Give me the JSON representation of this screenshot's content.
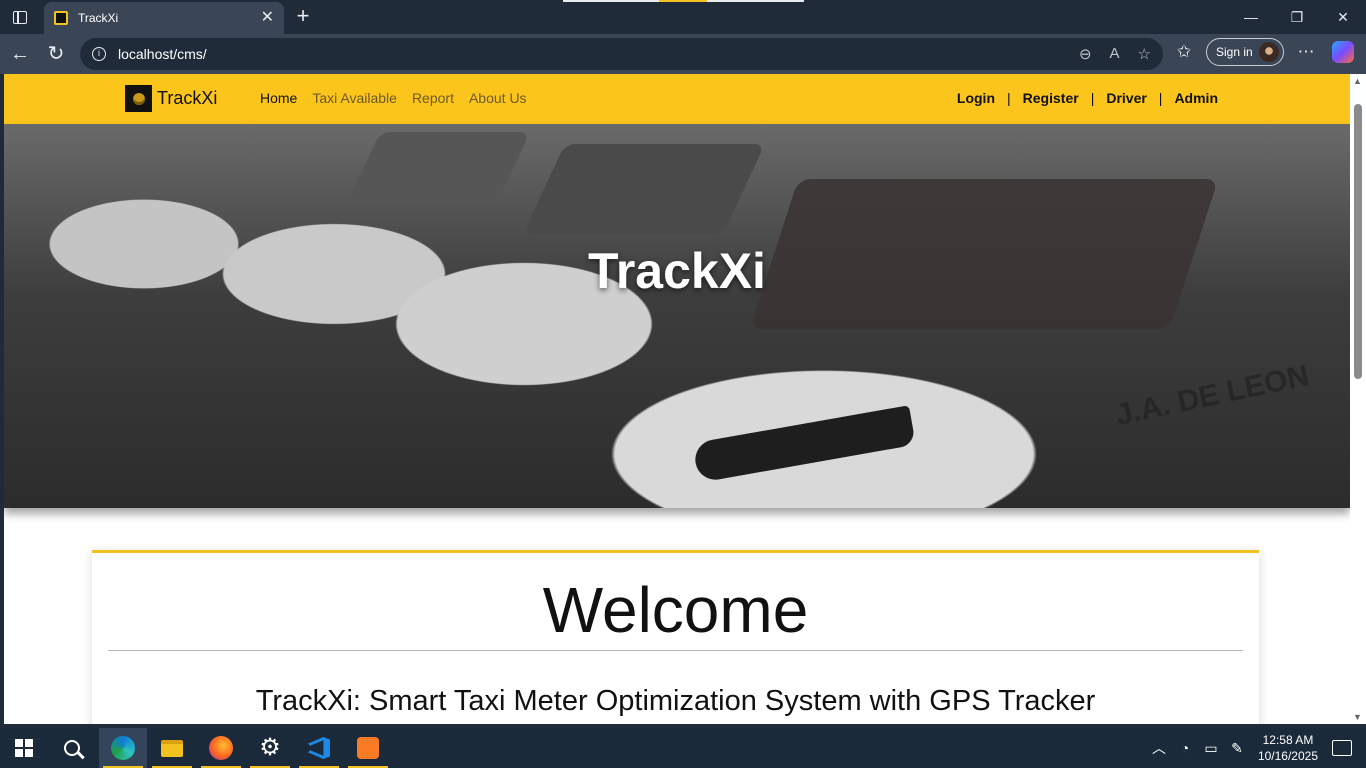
{
  "browser": {
    "tab_title": "TrackXi",
    "url": "localhost/cms/",
    "signin_label": "Sign in",
    "close_tab": "✕",
    "new_tab": "+"
  },
  "site": {
    "brand": "TrackXi",
    "menu": [
      "Home",
      "Taxi Available",
      "Report",
      "About Us"
    ],
    "auth": [
      "Login",
      "Register",
      "Driver",
      "Admin"
    ],
    "separator": "|",
    "accent": "#fcc51b"
  },
  "hero": {
    "title": "TrackXi",
    "door_text": "J.A. DE LEON"
  },
  "card": {
    "heading": "Welcome",
    "subtitle": "TrackXi: Smart Taxi Meter Optimization System with GPS Tracker"
  },
  "taskbar": {
    "time": "12:58 AM",
    "date": "10/16/2025"
  }
}
